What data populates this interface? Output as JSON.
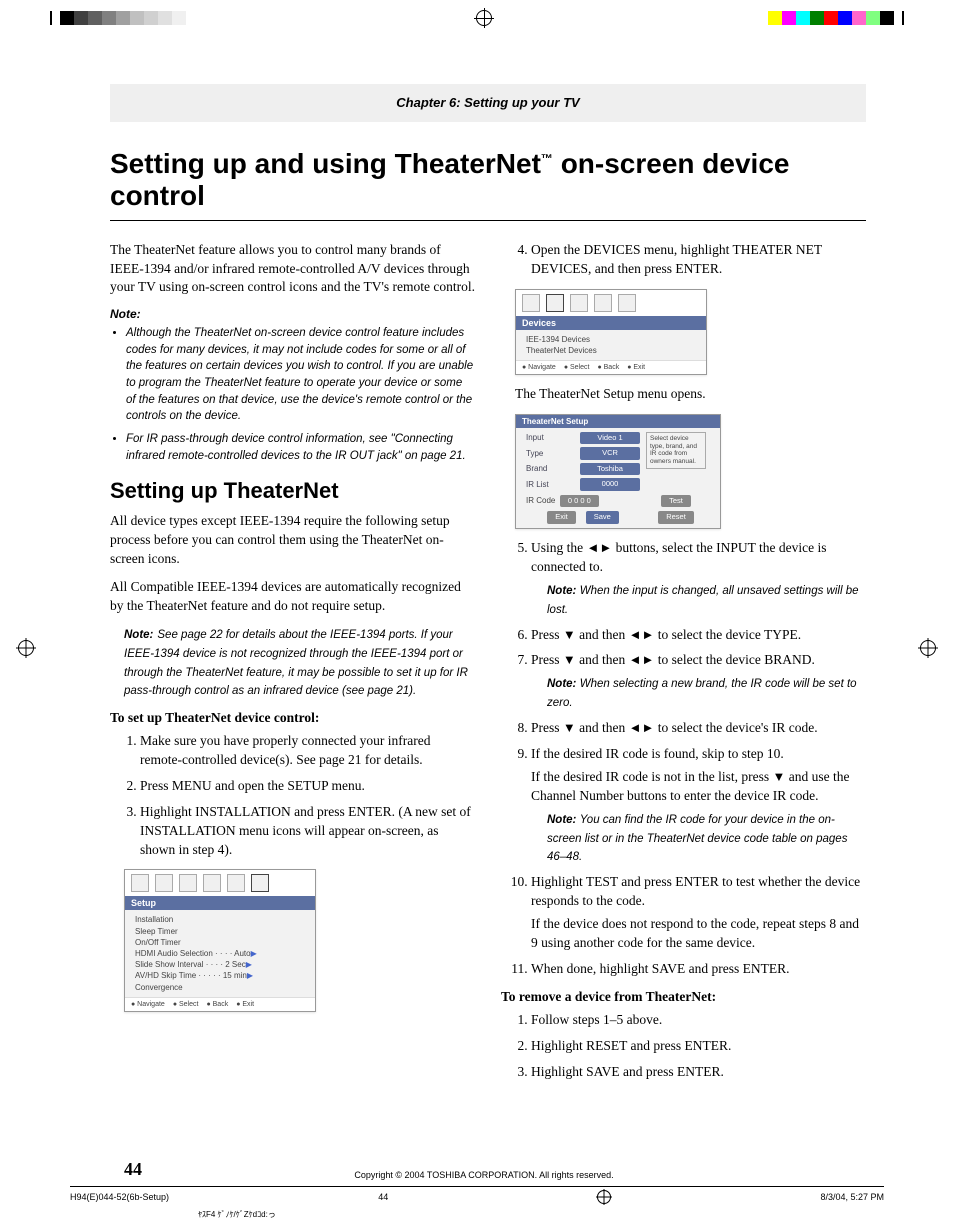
{
  "registration_colors_left": [
    "#000",
    "#404040",
    "#606060",
    "#808080",
    "#a0a0a0",
    "#c0c0c0",
    "#d0d0d0",
    "#e0e0e0",
    "#f0f0f0",
    "#ffffff"
  ],
  "registration_colors_right": [
    "#ffff00",
    "#ff00ff",
    "#00ffff",
    "#008000",
    "#ff0000",
    "#0000ff",
    "#ff66cc",
    "#80ff80",
    "#000000"
  ],
  "chapter": "Chapter 6: Setting up your TV",
  "title_a": "Setting up and using TheaterNet",
  "title_tm": "™",
  "title_b": " on-screen device control",
  "intro": "The TheaterNet feature allows you to control many brands of IEEE-1394 and/or infrared remote-controlled A/V devices through your TV using on-screen control icons and the TV's remote control.",
  "note_label": "Note:",
  "note1": "Although the TheaterNet on-screen device control feature includes codes for many devices, it may not include codes for some or all of the features on certain devices you wish to control. If you are unable to program the TheaterNet feature to operate your device or some of the features on that device, use the device's remote control or the controls on the device.",
  "note2": "For IR pass-through device control information, see \"Connecting infrared remote-controlled devices to the IR OUT jack\" on page 21.",
  "section2": "Setting up TheaterNet",
  "p2a": "All device types except IEEE-1394 require the following setup process before you can control them using the TheaterNet on-screen icons.",
  "p2b": "All Compatible IEEE-1394 devices are automatically recognized by the TheaterNet feature and do not require setup.",
  "ieee_note": "See page 22 for details about the IEEE-1394 ports. If your IEEE-1394 device is not recognized through the IEEE-1394 port or through the TheaterNet feature, it may be possible to set it up for IR pass-through control as an infrared device (see page 21).",
  "setup_heading": "To set up TheaterNet device control:",
  "steps_left": {
    "s1": "Make sure you have properly connected your infrared remote-controlled device(s). See page 21 for details.",
    "s2": "Press MENU and open the SETUP menu.",
    "s3": "Highlight INSTALLATION and press ENTER. (A new set of INSTALLATION menu icons will appear on-screen, as shown in step 4)."
  },
  "setup_menu": {
    "title": "Setup",
    "items": [
      "Installation",
      "Sleep Timer",
      "On/Off Timer",
      "HDMI Audio Selection · · · · Auto",
      "Slide Show Interval · · · · 2 Sec",
      "AV/HD Skip Time · · · · · 15 min",
      "Convergence"
    ],
    "footer": [
      "Navigate",
      "Select",
      "Back",
      "Exit"
    ]
  },
  "steps_right": {
    "s4": "Open the DEVICES menu, highlight THEATER NET DEVICES, and then press ENTER."
  },
  "devices_menu": {
    "title": "Devices",
    "items": [
      "IEE-1394 Devices",
      "TheaterNet Devices"
    ],
    "footer": [
      "Navigate",
      "Select",
      "Back",
      "Exit"
    ]
  },
  "after_devices": "The TheaterNet Setup menu opens.",
  "tn_setup": {
    "title": "TheaterNet Setup",
    "rows": {
      "Input": "Video 1",
      "Type": "VCR",
      "Brand": "Toshiba",
      "IR List": "0000",
      "IR Code": "0 0 0 0"
    },
    "hint": "Select device type, brand, and IR code from owners manual.",
    "buttons": [
      "Test",
      "Exit",
      "Save",
      "Reset"
    ]
  },
  "steps_right_cont": {
    "s5_a": "Using the ",
    "s5_b": " buttons, select the INPUT the device is connected to.",
    "s5_note": "When the input is changed, all unsaved settings will be lost.",
    "s6_a": "Press ",
    "s6_b": " and then ",
    "s6_c": " to select the device TYPE.",
    "s7_a": "Press ",
    "s7_b": " and then ",
    "s7_c": " to select the device BRAND.",
    "s7_note": "When selecting a new brand, the IR code will be set to zero.",
    "s8_a": "Press ",
    "s8_b": " and then ",
    "s8_c": " to select the device's IR code.",
    "s9a": "If the desired IR code is found, skip to step 10.",
    "s9b_a": "If the desired IR code is not in the list, press ",
    "s9b_b": " and use the Channel Number buttons to enter the device IR code.",
    "s9_note": "You can find the IR code for your device in the on-screen list or in the TheaterNet device code table on pages 46–48.",
    "s10a": "Highlight TEST and press ENTER to test whether the device responds to the code.",
    "s10b": "If the device does not respond to the code, repeat steps 8 and 9 using another code for the same device.",
    "s11": "When done, highlight SAVE and press ENTER."
  },
  "remove_heading": "To remove a device from TheaterNet:",
  "remove_steps": {
    "r1": "Follow steps 1–5 above.",
    "r2": "Highlight RESET and press ENTER.",
    "r3": "Highlight SAVE and press ENTER."
  },
  "glyphs": {
    "left": "◄",
    "right": "►",
    "down": "▼"
  },
  "page_number": "44",
  "copyright": "Copyright © 2004 TOSHIBA CORPORATION. All rights reserved.",
  "slug_left": "H94(E)044-52(6b-Setup)",
  "slug_mid": "44",
  "slug_right": "8/3/04, 5:27 PM",
  "tiny": "ﾔｽF4 ｹﾞﾉｹ/ｹﾞZｹdｺd:っ"
}
